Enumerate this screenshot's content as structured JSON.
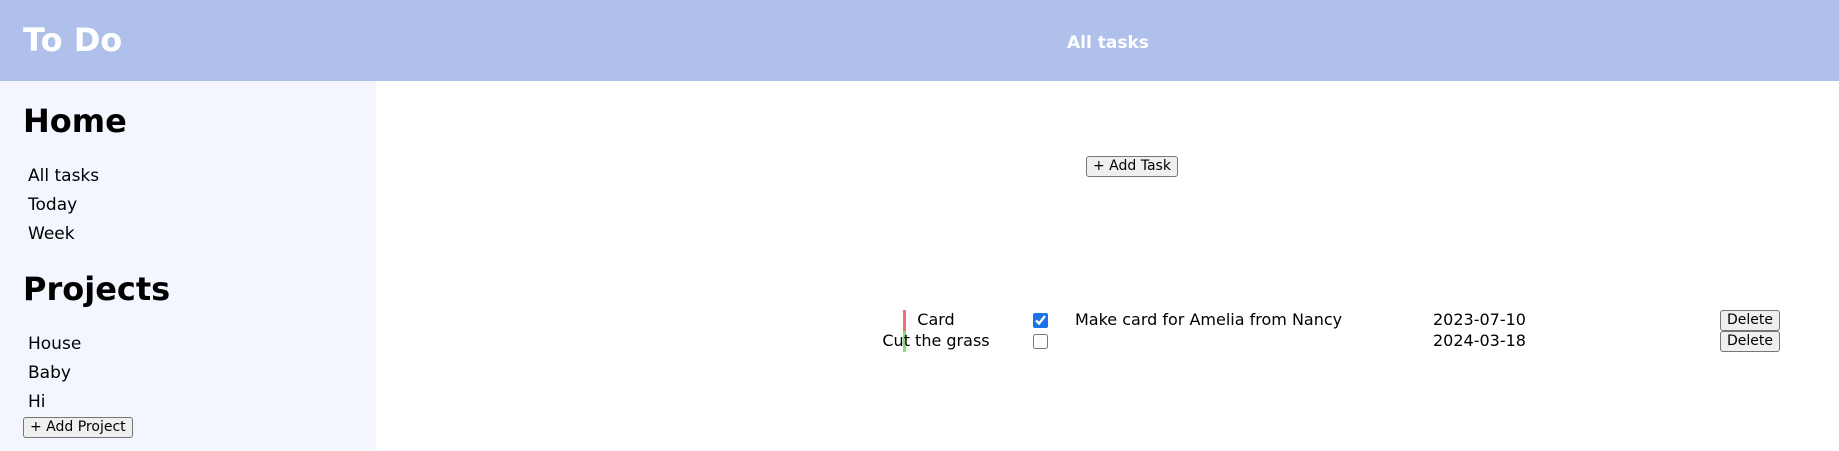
{
  "header": {
    "app_title": "To Do",
    "view_title": "All tasks"
  },
  "sidebar": {
    "home_heading": "Home",
    "home_items": [
      {
        "label": "All tasks"
      },
      {
        "label": "Today"
      },
      {
        "label": "Week"
      }
    ],
    "projects_heading": "Projects",
    "project_items": [
      {
        "label": "House"
      },
      {
        "label": "Baby"
      },
      {
        "label": "Hi"
      }
    ],
    "add_project_label": "+ Add Project"
  },
  "main": {
    "add_task_label": "+ Add Task",
    "tasks": [
      {
        "priority_color": "#f07070",
        "completed": true,
        "title": "Card",
        "description": "Make card for Amelia from Nancy",
        "due_date": "2023-07-10",
        "delete_label": "Delete"
      },
      {
        "priority_color": "#88dd77",
        "completed": false,
        "title": "Cut the grass",
        "description": "",
        "due_date": "2024-03-18",
        "delete_label": "Delete"
      }
    ]
  },
  "colors": {
    "header_bg": "#afc0ea",
    "sidebar_bg": "#f3f6fe"
  }
}
